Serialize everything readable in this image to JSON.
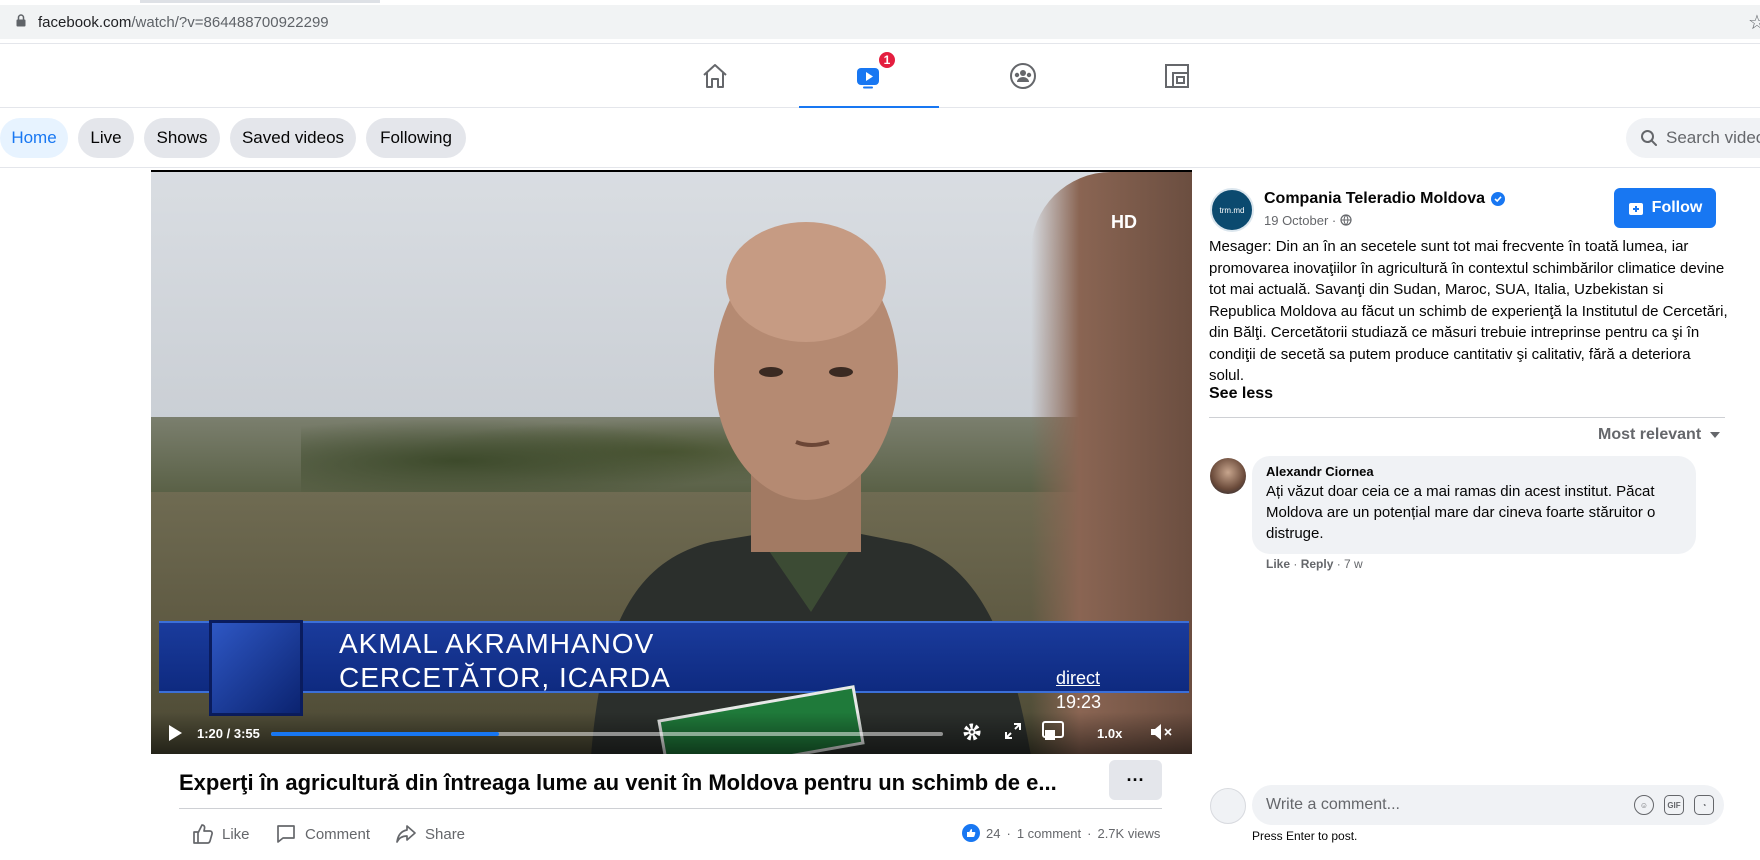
{
  "browser": {
    "url_host": "facebook.com",
    "url_path": "/watch/?v=864488700922299"
  },
  "topnav": {
    "notifications_badge": "1"
  },
  "filters": {
    "chips": [
      "Home",
      "Live",
      "Shows",
      "Saved videos",
      "Following"
    ],
    "search_placeholder": "Search video"
  },
  "video": {
    "watermark": "HD",
    "lower_third_name": "AKMAL  AKRAMHANOV",
    "lower_third_role": "CERCETĂTOR,  ICARDA",
    "channel_tag": "direct",
    "clock": "19:23",
    "time": "1:20 / 3:55",
    "progress_fraction": 0.34,
    "speed": "1.0x",
    "title": "Experţi în agricultură din întreaga lume au venit în Moldova pentru un schimb de e...",
    "more_label": "···"
  },
  "actions": {
    "like": "Like",
    "comment": "Comment",
    "share": "Share",
    "reactions": "24",
    "comments_count": "1 comment",
    "views": "2.7K views"
  },
  "post": {
    "page_name": "Compania Teleradio Moldova",
    "avatar_text": "trm.md",
    "date": "19 October ·",
    "follow_label": "Follow",
    "description": "Mesager: Din an în an secetele sunt tot mai frecvente în toată lumea, iar promovarea inovaţiilor în agricultură în contextul schimbărilor climatice devine tot mai actuală. Savanţi din Sudan, Maroc, SUA, Italia, Uzbekistan si Republica Moldova au făcut un schimb de experienţă la Institutul de Cercetări, din Bălţi. Cercetătorii studiază ce măsuri trebuie intreprinse pentru ca şi în condiţii de secetă sa putem produce cantitativ şi calitativ, fără a deteriora solul.",
    "see_less": "See less",
    "sort_label": "Most relevant"
  },
  "comment": {
    "author": "Alexandr Ciornea",
    "text": "Ați văzut doar ceia ce a mai ramas din acest institut. Păcat Moldova are un potențial mare dar cineva foarte stăruitor o distruge.",
    "like": "Like",
    "reply": "Reply",
    "age": "7 w"
  },
  "composer": {
    "placeholder": "Write a comment...",
    "hint": "Press Enter to post.",
    "gif": "GIF"
  },
  "colors": {
    "accent": "#1877f2",
    "badge": "#e41e3f"
  }
}
